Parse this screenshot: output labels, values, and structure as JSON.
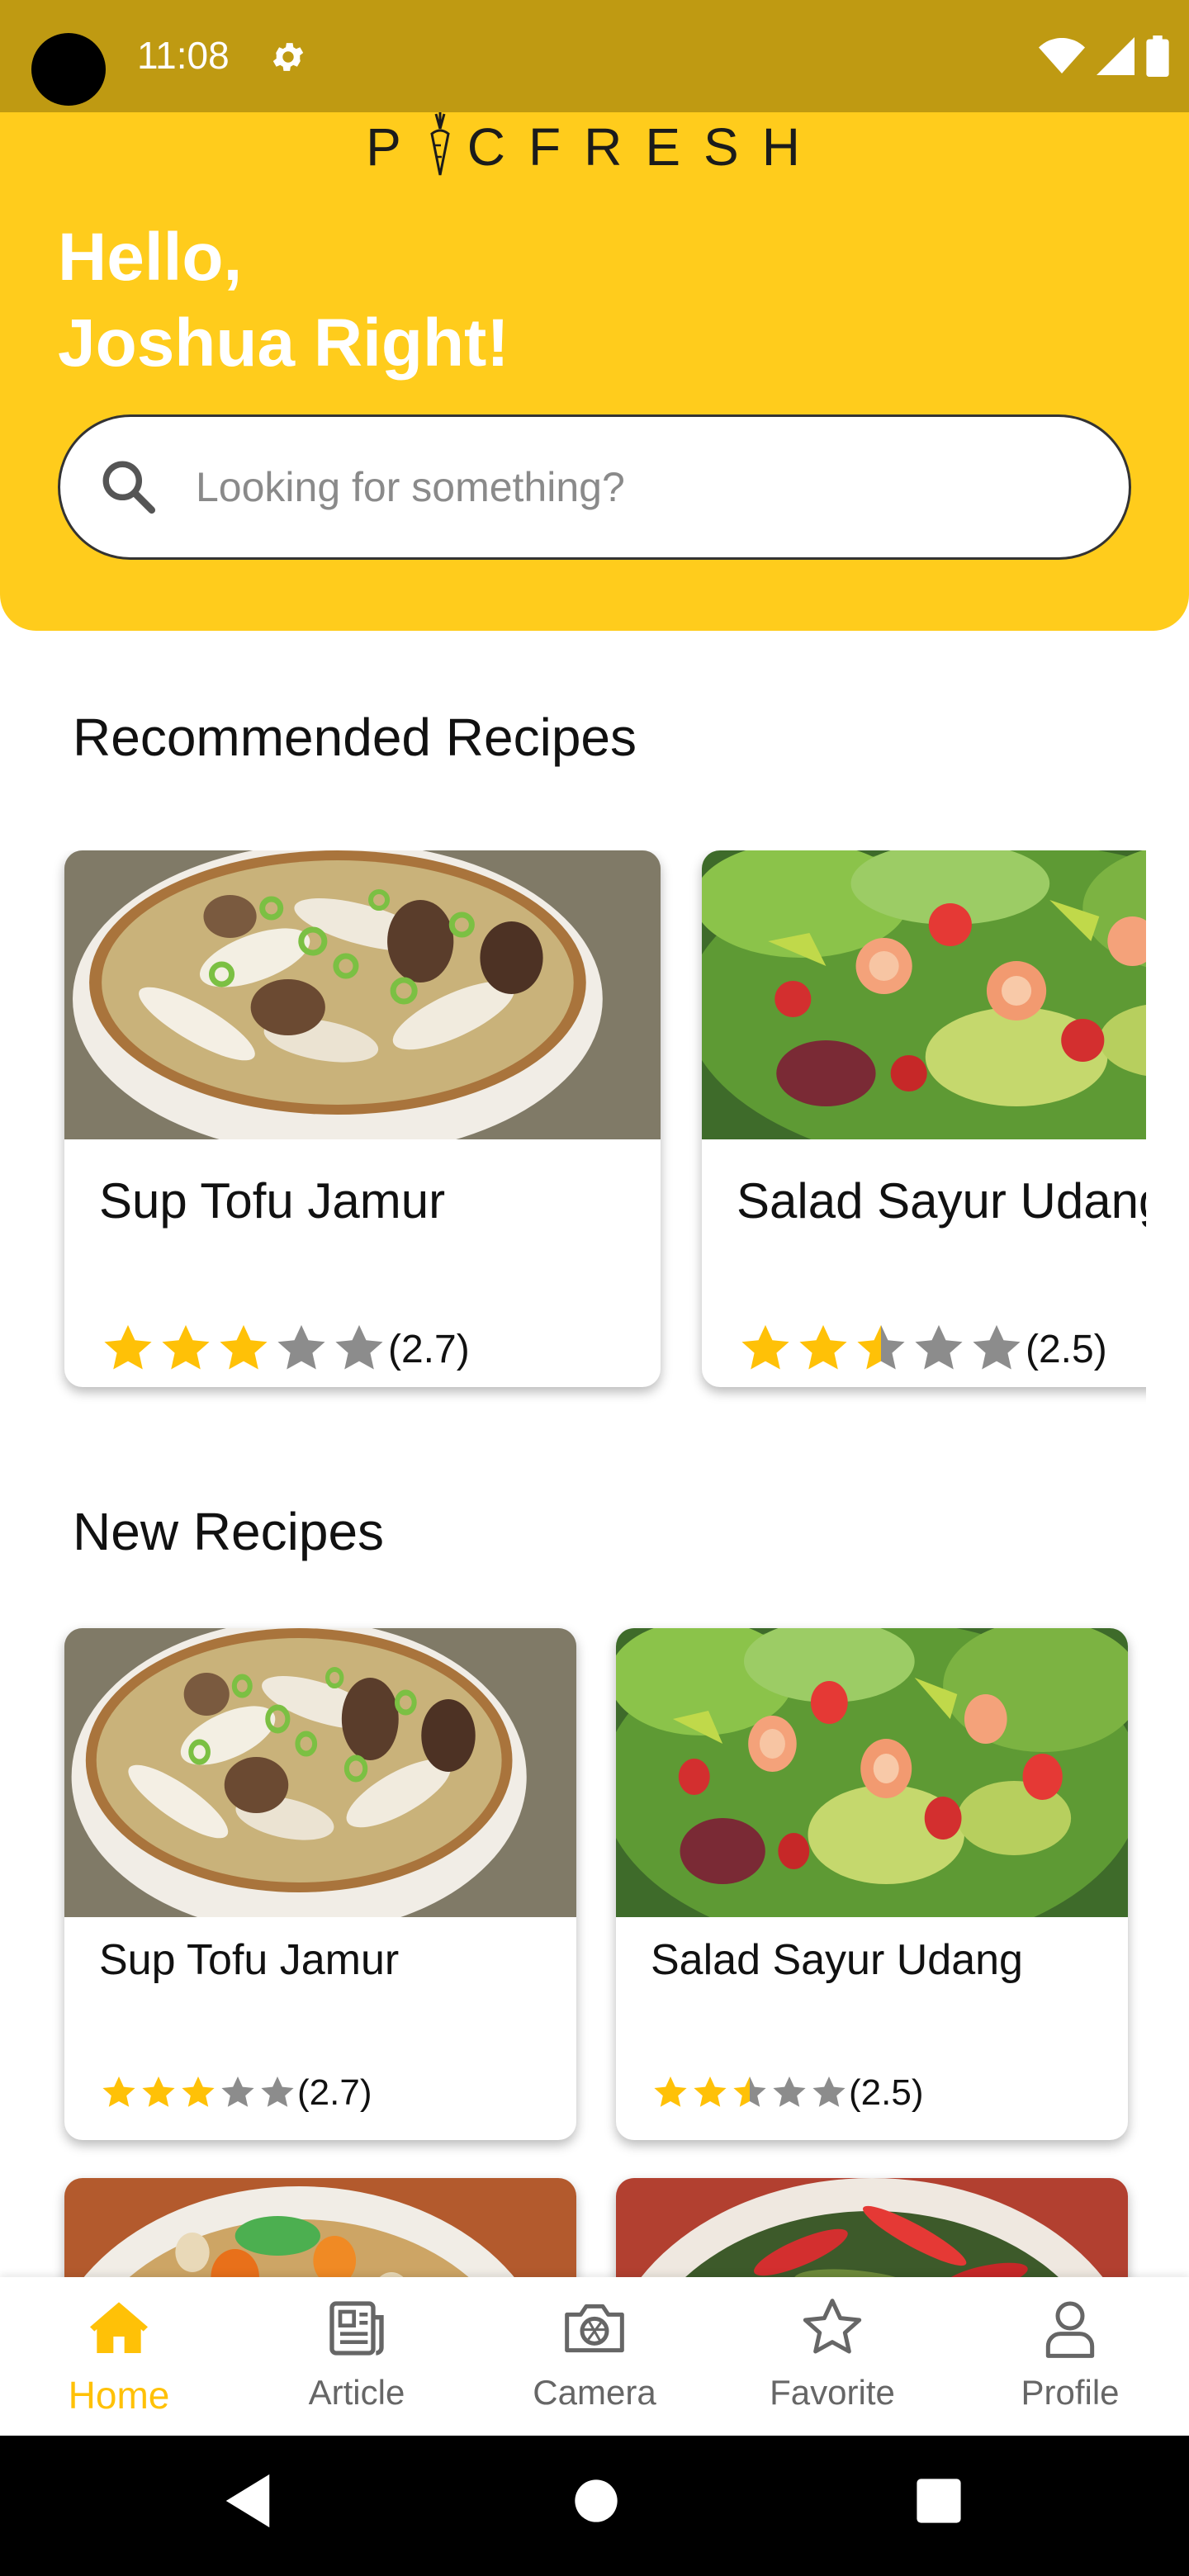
{
  "status_bar": {
    "time": "11:08",
    "icons": [
      "settings-icon",
      "wifi-icon",
      "signal-icon",
      "battery-icon"
    ]
  },
  "app": {
    "logo_text": "PICFRESH",
    "brand_color": "#FFCC1C",
    "status_color": "#BF9A12",
    "star_color": "#FFC107"
  },
  "header": {
    "greeting_line1": "Hello,",
    "greeting_line2": "Joshua Right!",
    "search_placeholder": "Looking for something?"
  },
  "recommended": {
    "title": "Recommended Recipes",
    "recipes": [
      {
        "name": "Sup Tofu Jamur",
        "rating": 2.7,
        "rating_text": "(2.7)",
        "image": "mushroom-tofu-soup"
      },
      {
        "name": "Salad Sayur Udang",
        "rating": 2.5,
        "rating_text": "(2.5)",
        "image": "shrimp-vegetable-salad"
      }
    ]
  },
  "new_recipes": {
    "title": "New Recipes",
    "recipes": [
      {
        "name": "Sup Tofu Jamur",
        "rating": 2.7,
        "rating_text": "(2.7)",
        "image": "mushroom-tofu-soup"
      },
      {
        "name": "Salad Sayur Udang",
        "rating": 2.5,
        "rating_text": "(2.5)",
        "image": "shrimp-vegetable-salad"
      },
      {
        "name": "",
        "image": "vegetable-soup"
      },
      {
        "name": "",
        "image": "chili-stir-fry"
      }
    ]
  },
  "bottom_nav": {
    "items": [
      {
        "label": "Home",
        "icon": "home-icon",
        "active": true
      },
      {
        "label": "Article",
        "icon": "article-icon",
        "active": false
      },
      {
        "label": "Camera",
        "icon": "camera-icon",
        "active": false
      },
      {
        "label": "Favorite",
        "icon": "star-icon",
        "active": false
      },
      {
        "label": "Profile",
        "icon": "profile-icon",
        "active": false
      }
    ]
  },
  "system_nav": {
    "buttons": [
      "back-icon",
      "home-circle-icon",
      "recents-icon"
    ]
  }
}
